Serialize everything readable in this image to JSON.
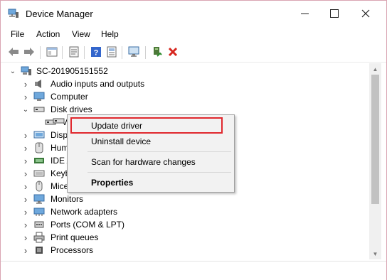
{
  "window": {
    "title": "Device Manager",
    "minimize_glyph": "—",
    "maximize_glyph": "☐",
    "close_glyph": "✕"
  },
  "menu": [
    "File",
    "Action",
    "View",
    "Help"
  ],
  "toolbar": {
    "icons": [
      "back-icon",
      "forward-icon",
      "show-hide-console-tree-icon",
      "properties-icon",
      "help-icon",
      "monitor-icon",
      "update-driver-icon",
      "uninstall-icon"
    ]
  },
  "tree": {
    "root": "SC-201905151552",
    "items": [
      {
        "label": "Audio inputs and outputs",
        "icon": "speaker-icon",
        "expanded": false
      },
      {
        "label": "Computer",
        "icon": "computer-icon",
        "expanded": false
      },
      {
        "label": "Disk drives",
        "icon": "disk-drive-icon",
        "expanded": true
      },
      {
        "label": "V",
        "icon": "disk-drive-icon",
        "child": true
      },
      {
        "label": "Disp",
        "icon": "display-adapter-icon",
        "expanded": false
      },
      {
        "label": "Hum",
        "icon": "hid-icon",
        "expanded": false
      },
      {
        "label": "IDE A",
        "icon": "ide-controller-icon",
        "expanded": false
      },
      {
        "label": "Keyb",
        "icon": "keyboard-icon",
        "expanded": false
      },
      {
        "label": "Mice",
        "icon": "mouse-icon",
        "expanded": false
      },
      {
        "label": "Monitors",
        "icon": "monitor-icon",
        "expanded": false
      },
      {
        "label": "Network adapters",
        "icon": "network-adapter-icon",
        "expanded": false
      },
      {
        "label": "Ports (COM & LPT)",
        "icon": "port-icon",
        "expanded": false
      },
      {
        "label": "Print queues",
        "icon": "printer-icon",
        "expanded": false
      },
      {
        "label": "Processors",
        "icon": "processor-icon",
        "expanded": false
      }
    ]
  },
  "context_menu": {
    "update_driver": "Update driver",
    "uninstall_device": "Uninstall device",
    "scan_hardware": "Scan for hardware changes",
    "properties": "Properties"
  },
  "colors": {
    "highlight_border": "#e0282e",
    "window_border": "#d9a5b3",
    "menu_bg": "#f2f2f2"
  }
}
